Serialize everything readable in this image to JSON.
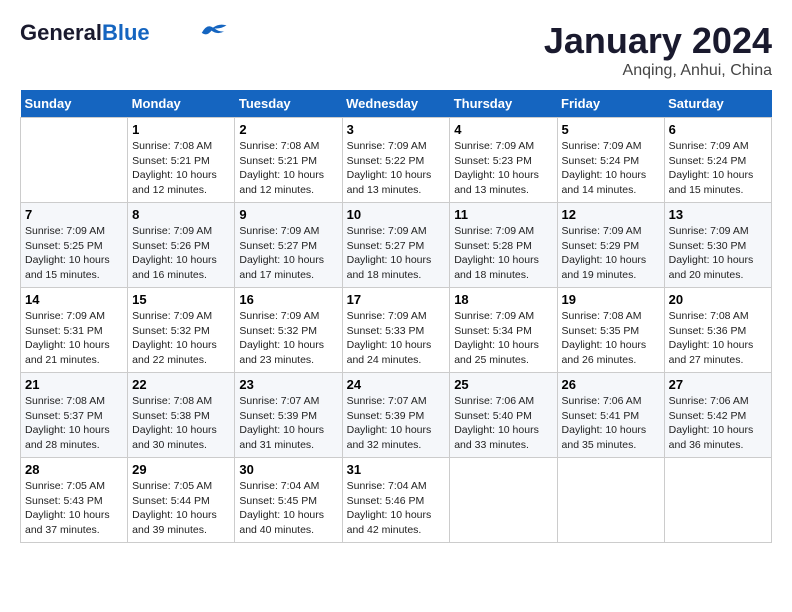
{
  "header": {
    "logo_general": "General",
    "logo_blue": "Blue",
    "month": "January 2024",
    "location": "Anqing, Anhui, China"
  },
  "days_of_week": [
    "Sunday",
    "Monday",
    "Tuesday",
    "Wednesday",
    "Thursday",
    "Friday",
    "Saturday"
  ],
  "weeks": [
    [
      null,
      {
        "n": 1,
        "sunrise": "7:08 AM",
        "sunset": "5:21 PM",
        "daylight": "10 hours and 12 minutes."
      },
      {
        "n": 2,
        "sunrise": "7:08 AM",
        "sunset": "5:21 PM",
        "daylight": "10 hours and 12 minutes."
      },
      {
        "n": 3,
        "sunrise": "7:09 AM",
        "sunset": "5:22 PM",
        "daylight": "10 hours and 13 minutes."
      },
      {
        "n": 4,
        "sunrise": "7:09 AM",
        "sunset": "5:23 PM",
        "daylight": "10 hours and 13 minutes."
      },
      {
        "n": 5,
        "sunrise": "7:09 AM",
        "sunset": "5:24 PM",
        "daylight": "10 hours and 14 minutes."
      },
      {
        "n": 6,
        "sunrise": "7:09 AM",
        "sunset": "5:24 PM",
        "daylight": "10 hours and 15 minutes."
      }
    ],
    [
      {
        "n": 7,
        "sunrise": "7:09 AM",
        "sunset": "5:25 PM",
        "daylight": "10 hours and 15 minutes."
      },
      {
        "n": 8,
        "sunrise": "7:09 AM",
        "sunset": "5:26 PM",
        "daylight": "10 hours and 16 minutes."
      },
      {
        "n": 9,
        "sunrise": "7:09 AM",
        "sunset": "5:27 PM",
        "daylight": "10 hours and 17 minutes."
      },
      {
        "n": 10,
        "sunrise": "7:09 AM",
        "sunset": "5:27 PM",
        "daylight": "10 hours and 18 minutes."
      },
      {
        "n": 11,
        "sunrise": "7:09 AM",
        "sunset": "5:28 PM",
        "daylight": "10 hours and 18 minutes."
      },
      {
        "n": 12,
        "sunrise": "7:09 AM",
        "sunset": "5:29 PM",
        "daylight": "10 hours and 19 minutes."
      },
      {
        "n": 13,
        "sunrise": "7:09 AM",
        "sunset": "5:30 PM",
        "daylight": "10 hours and 20 minutes."
      }
    ],
    [
      {
        "n": 14,
        "sunrise": "7:09 AM",
        "sunset": "5:31 PM",
        "daylight": "10 hours and 21 minutes."
      },
      {
        "n": 15,
        "sunrise": "7:09 AM",
        "sunset": "5:32 PM",
        "daylight": "10 hours and 22 minutes."
      },
      {
        "n": 16,
        "sunrise": "7:09 AM",
        "sunset": "5:32 PM",
        "daylight": "10 hours and 23 minutes."
      },
      {
        "n": 17,
        "sunrise": "7:09 AM",
        "sunset": "5:33 PM",
        "daylight": "10 hours and 24 minutes."
      },
      {
        "n": 18,
        "sunrise": "7:09 AM",
        "sunset": "5:34 PM",
        "daylight": "10 hours and 25 minutes."
      },
      {
        "n": 19,
        "sunrise": "7:08 AM",
        "sunset": "5:35 PM",
        "daylight": "10 hours and 26 minutes."
      },
      {
        "n": 20,
        "sunrise": "7:08 AM",
        "sunset": "5:36 PM",
        "daylight": "10 hours and 27 minutes."
      }
    ],
    [
      {
        "n": 21,
        "sunrise": "7:08 AM",
        "sunset": "5:37 PM",
        "daylight": "10 hours and 28 minutes."
      },
      {
        "n": 22,
        "sunrise": "7:08 AM",
        "sunset": "5:38 PM",
        "daylight": "10 hours and 30 minutes."
      },
      {
        "n": 23,
        "sunrise": "7:07 AM",
        "sunset": "5:39 PM",
        "daylight": "10 hours and 31 minutes."
      },
      {
        "n": 24,
        "sunrise": "7:07 AM",
        "sunset": "5:39 PM",
        "daylight": "10 hours and 32 minutes."
      },
      {
        "n": 25,
        "sunrise": "7:06 AM",
        "sunset": "5:40 PM",
        "daylight": "10 hours and 33 minutes."
      },
      {
        "n": 26,
        "sunrise": "7:06 AM",
        "sunset": "5:41 PM",
        "daylight": "10 hours and 35 minutes."
      },
      {
        "n": 27,
        "sunrise": "7:06 AM",
        "sunset": "5:42 PM",
        "daylight": "10 hours and 36 minutes."
      }
    ],
    [
      {
        "n": 28,
        "sunrise": "7:05 AM",
        "sunset": "5:43 PM",
        "daylight": "10 hours and 37 minutes."
      },
      {
        "n": 29,
        "sunrise": "7:05 AM",
        "sunset": "5:44 PM",
        "daylight": "10 hours and 39 minutes."
      },
      {
        "n": 30,
        "sunrise": "7:04 AM",
        "sunset": "5:45 PM",
        "daylight": "10 hours and 40 minutes."
      },
      {
        "n": 31,
        "sunrise": "7:04 AM",
        "sunset": "5:46 PM",
        "daylight": "10 hours and 42 minutes."
      },
      null,
      null,
      null
    ]
  ]
}
